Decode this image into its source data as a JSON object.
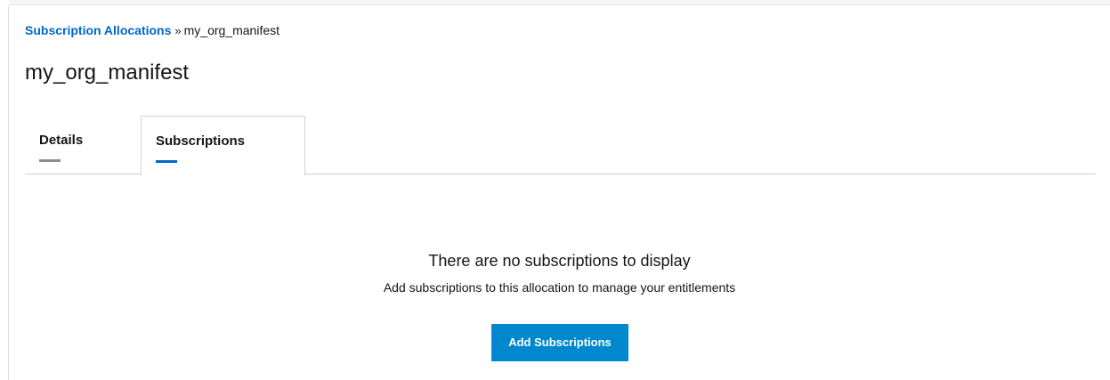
{
  "breadcrumb": {
    "parent": "Subscription Allocations",
    "separator": "»",
    "current": "my_org_manifest"
  },
  "page": {
    "title": "my_org_manifest"
  },
  "tabs": [
    {
      "label": "Details",
      "active": false
    },
    {
      "label": "Subscriptions",
      "active": true
    }
  ],
  "empty_state": {
    "title": "There are no subscriptions to display",
    "body": "Add subscriptions to this allocation to manage your entitlements",
    "button_label": "Add Subscriptions"
  },
  "colors": {
    "link": "#0066cc",
    "active_tab_indicator": "#0066cc",
    "inactive_tab_indicator": "#8a8d90",
    "primary_button": "#0088ce",
    "text": "#151515",
    "border": "#d2d2d2"
  }
}
